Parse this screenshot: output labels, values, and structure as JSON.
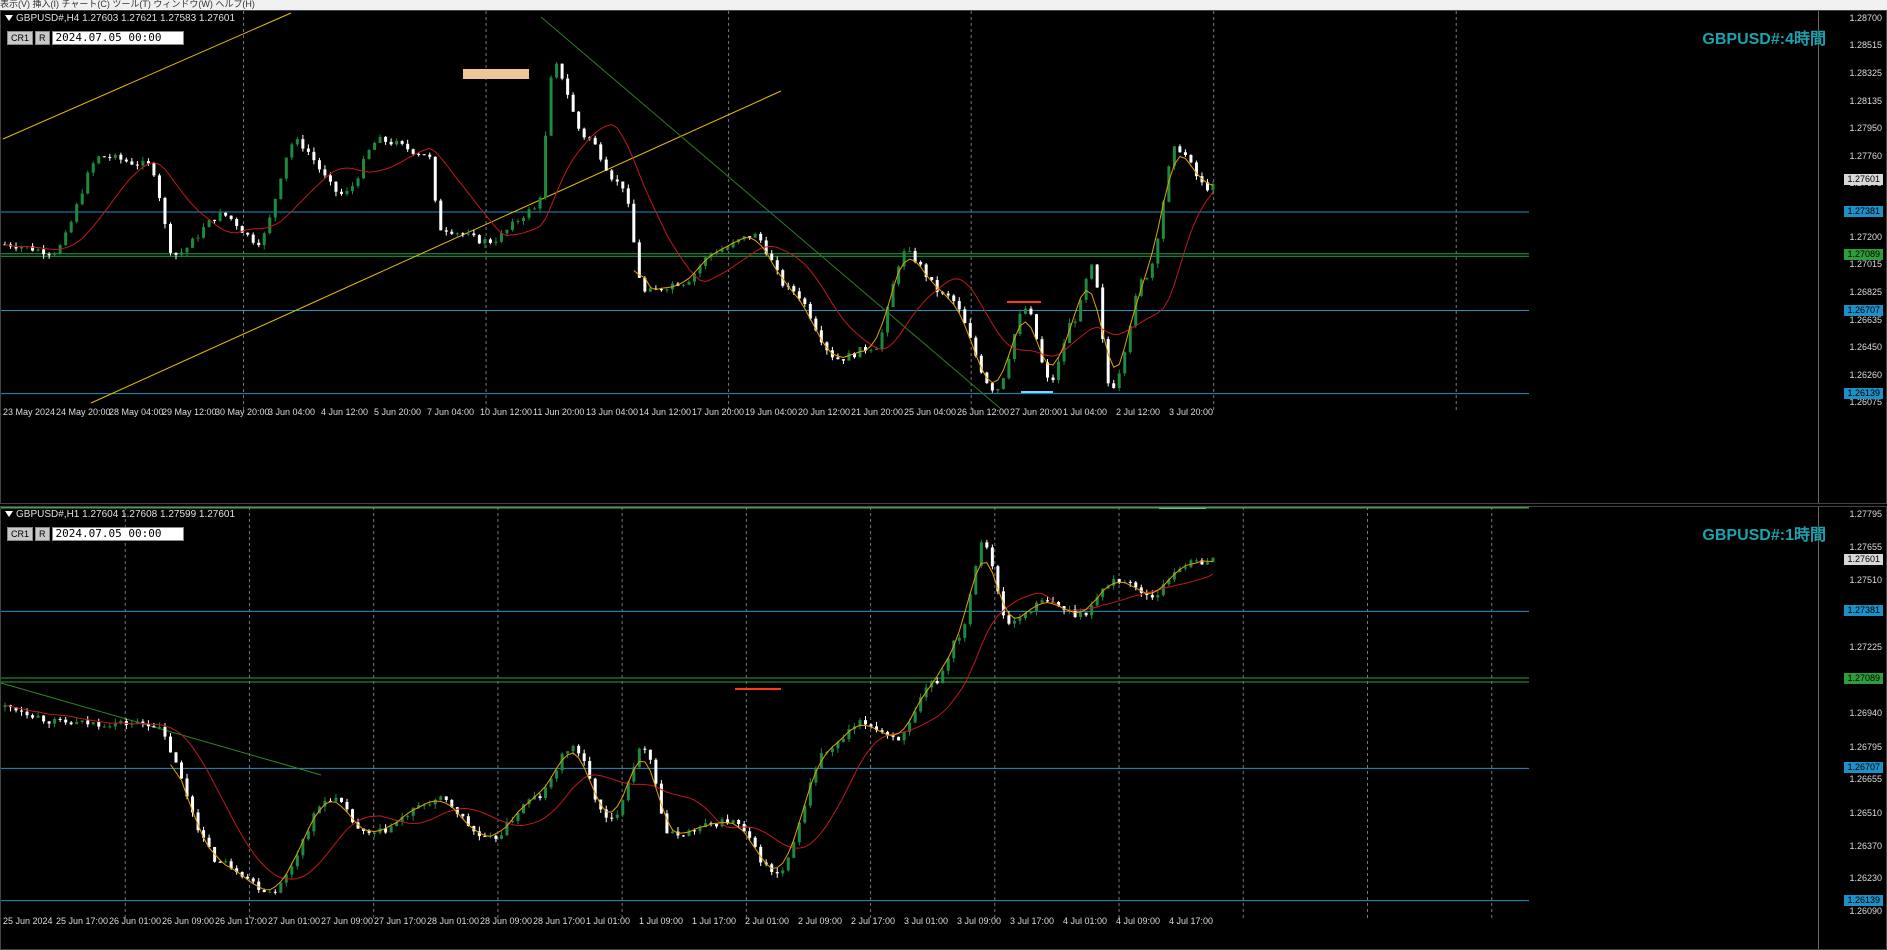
{
  "topbar": {
    "menu_text": "表示(V)  挿入(I)  チャート(C)  ツール(T)  ウィンドウ(W)  ヘルプ(H)"
  },
  "colors": {
    "background": "#000000",
    "bull": "#1e8a3c",
    "bear": "#ffffff",
    "ma": "#c0191d",
    "zigzag": "#e5a100",
    "hline": "#1e90c8",
    "trend_yellow": "#e6c200",
    "trend_green": "#2d7a22",
    "label": "#1aa3b0"
  },
  "panels": [
    {
      "id": "h4",
      "info": "GBPUSD#,H4  1.27603 1.27621 1.27583 1.27601",
      "cr_button": "CR1",
      "r_button": "R",
      "date": "2024.07.05 00:00",
      "symbol_label": "GBPUSD#:4時間",
      "price_range": [
        1.26075,
        1.287
      ],
      "price_ticks": [
        "1.28700",
        "1.28515",
        "1.28325",
        "1.28135",
        "1.27950",
        "1.27760",
        "1.27575",
        "1.27390",
        "1.27200",
        "1.27015",
        "1.26825",
        "1.26635",
        "1.26450",
        "1.26260",
        "1.26075"
      ],
      "price_tags": [
        {
          "text": "1.27601",
          "value": 1.27601,
          "bg": "#d8d8d8",
          "fg": "#000000"
        },
        {
          "text": "1.27381",
          "value": 1.27381,
          "bg": "#1e90c8",
          "fg": "#000000"
        },
        {
          "text": "1.27089",
          "value": 1.27089,
          "bg": "#2e9e3a",
          "fg": "#000000"
        },
        {
          "text": "1.26707",
          "value": 1.26707,
          "bg": "#1e90c8",
          "fg": "#000000"
        },
        {
          "text": "1.26139",
          "value": 1.26139,
          "bg": "#1e90c8",
          "fg": "#000000"
        }
      ],
      "hlines": [
        1.27381,
        1.27095,
        1.27078,
        1.26707,
        1.26139
      ],
      "time_labels": [
        "23 May 2024",
        "24 May 20:00",
        "28 May 04:00",
        "29 May 12:00",
        "30 May 20:00",
        "3 Jun 04:00",
        "4 Jun 12:00",
        "5 Jun 20:00",
        "7 Jun 04:00",
        "10 Jun 12:00",
        "11 Jun 20:00",
        "13 Jun 04:00",
        "14 Jun 12:00",
        "17 Jun 20:00",
        "19 Jun 04:00",
        "20 Jun 12:00",
        "21 Jun 20:00",
        "25 Jun 04:00",
        "26 Jun 12:00",
        "27 Jun 20:00",
        "1 Jul 04:00",
        "2 Jul 12:00",
        "3 Jul 20:00"
      ]
    },
    {
      "id": "h1",
      "info": "GBPUSD#,H1  1.27604 1.27608 1.27599 1.27601",
      "cr_button": "CR1",
      "r_button": "R",
      "date": "2024.07.05 00:00",
      "symbol_label": "GBPUSD#:1時間",
      "price_range": [
        1.2609,
        1.27795
      ],
      "price_ticks": [
        "1.27795",
        "1.27655",
        "1.27510",
        "1.27370",
        "1.27225",
        "1.27085",
        "1.26940",
        "1.26795",
        "1.26655",
        "1.26510",
        "1.26370",
        "1.26230",
        "1.26090"
      ],
      "price_tags": [
        {
          "text": "1.27601",
          "value": 1.27601,
          "bg": "#d8d8d8",
          "fg": "#000000"
        },
        {
          "text": "1.27381",
          "value": 1.27381,
          "bg": "#1e90c8",
          "fg": "#000000"
        },
        {
          "text": "1.27089",
          "value": 1.27089,
          "bg": "#2e9e3a",
          "fg": "#000000"
        },
        {
          "text": "1.26707",
          "value": 1.26707,
          "bg": "#1e90c8",
          "fg": "#000000"
        },
        {
          "text": "1.26139",
          "value": 1.26139,
          "bg": "#1e90c8",
          "fg": "#000000"
        }
      ],
      "hlines": [
        1.27381,
        1.27095,
        1.27078,
        1.26707,
        1.26139
      ],
      "time_labels": [
        "25 Jun 2024",
        "25 Jun 17:00",
        "26 Jun 01:00",
        "26 Jun 09:00",
        "26 Jun 17:00",
        "27 Jun 01:00",
        "27 Jun 09:00",
        "27 Jun 17:00",
        "28 Jun 01:00",
        "28 Jun 09:00",
        "28 Jun 17:00",
        "1 Jul 01:00",
        "1 Jul 09:00",
        "1 Jul 17:00",
        "2 Jul 01:00",
        "2 Jul 09:00",
        "2 Jul 17:00",
        "3 Jul 01:00",
        "3 Jul 09:00",
        "3 Jul 17:00",
        "4 Jul 01:00",
        "4 Jul 09:00",
        "4 Jul 17:00"
      ]
    }
  ]
}
